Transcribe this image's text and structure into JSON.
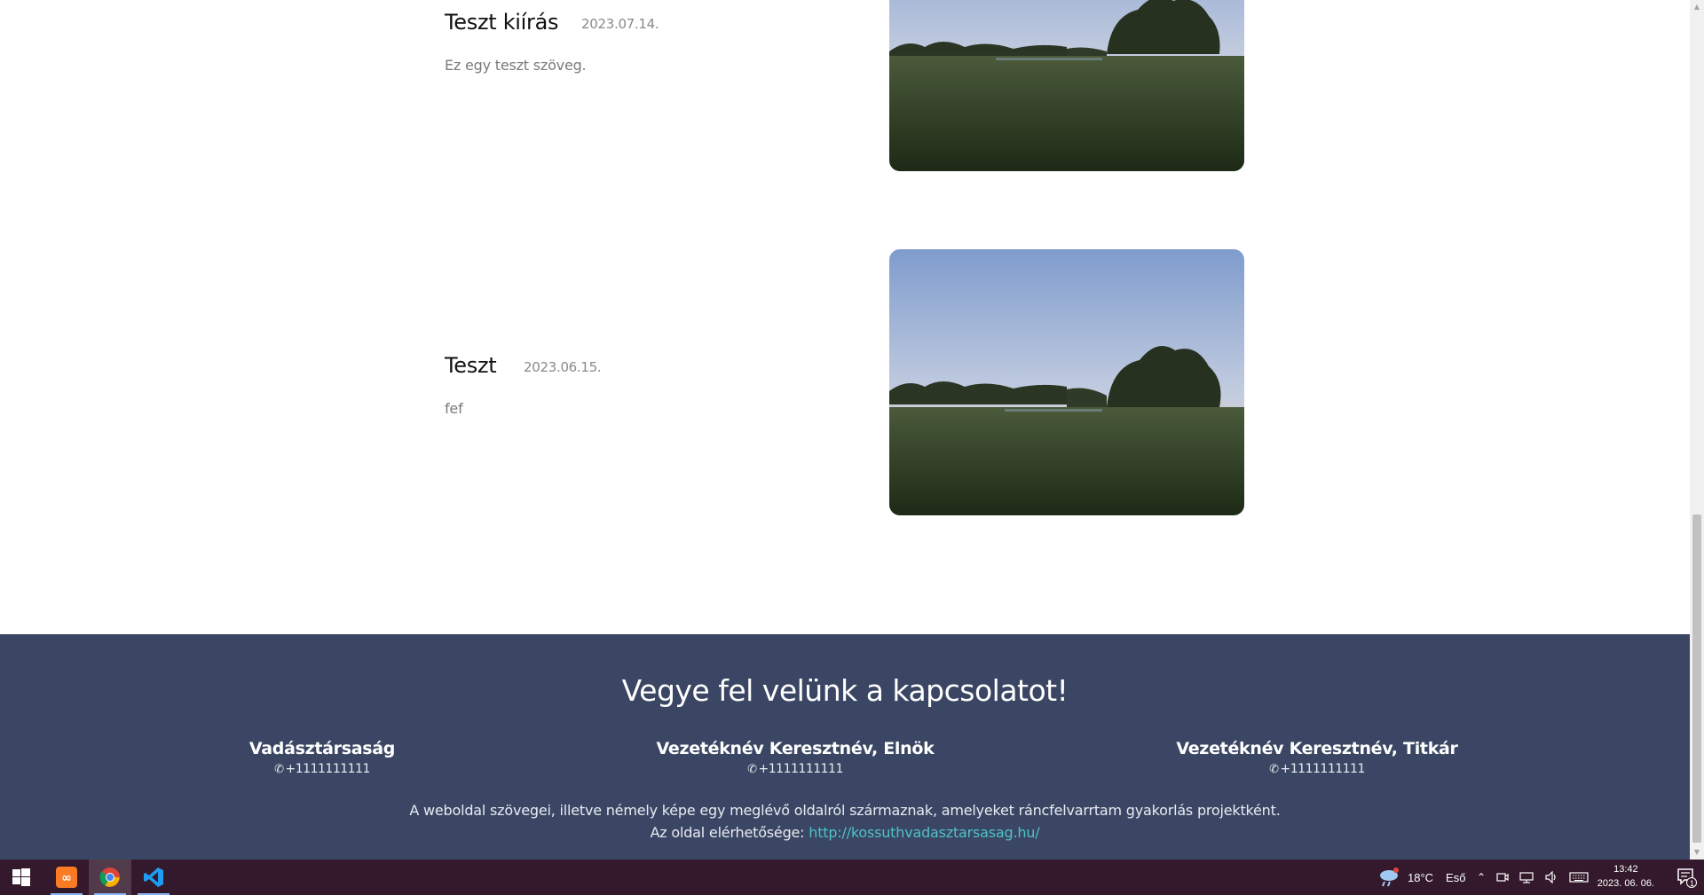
{
  "posts": [
    {
      "title": "Teszt kiírás",
      "date": "2023.07.14.",
      "text": "Ez egy teszt szöveg."
    },
    {
      "title": "Teszt",
      "date": "2023.06.15.",
      "text": "fef"
    }
  ],
  "footer": {
    "heading": "Vegye fel velünk a kapcsolatot!",
    "contacts": [
      {
        "name": "Vadásztársaság",
        "phone": "+1111111111"
      },
      {
        "name": "Vezetéknév Keresztnév, Elnök",
        "phone": "+1111111111"
      },
      {
        "name": "Vezetéknév Keresztnév, Titkár",
        "phone": "+1111111111"
      }
    ],
    "note": "A weboldal szövegei, illetve némely képe egy meglévő oldalról származnak, amelyeket ráncfelvarrtam gyakorlás projektként.",
    "link_prefix": "Az oldal elérhetősége: ",
    "link_text": "http://kossuthvadasztarsasag.hu/"
  },
  "taskbar": {
    "apps": [
      "windows-start",
      "xampp",
      "chrome",
      "vscode"
    ],
    "weather": {
      "temp": "18°C",
      "condition": "Eső"
    },
    "time": "13:42",
    "date": "2023. 06. 06.",
    "notification_count": "1"
  },
  "colors": {
    "footer_bg": "#3a4663",
    "link": "#4fc1c8",
    "taskbar_bg": "#33192b"
  }
}
